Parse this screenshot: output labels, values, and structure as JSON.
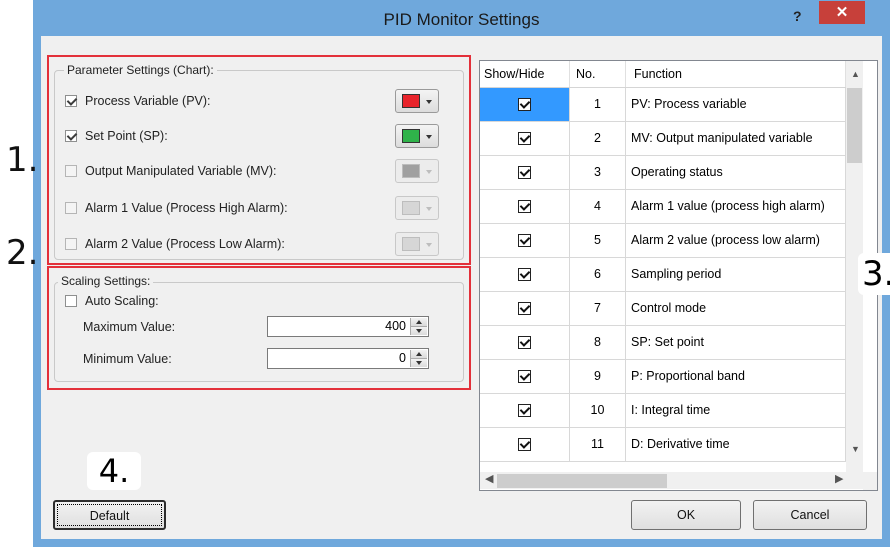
{
  "window": {
    "title": "PID Monitor Settings",
    "help": "?",
    "close": "✕"
  },
  "markers": {
    "m1": "1.",
    "m2": "2.",
    "m3": "3.",
    "m4": "4."
  },
  "params": {
    "group_label": "Parameter Settings (Chart):",
    "items": [
      {
        "label": "Process Variable (PV):",
        "checked": true,
        "enabled": true,
        "color": "#e8242b"
      },
      {
        "label": "Set Point (SP):",
        "checked": true,
        "enabled": true,
        "color": "#2fb34a"
      },
      {
        "label": "Output Manipulated Variable (MV):",
        "checked": false,
        "enabled": false,
        "color": "#a0a0a0"
      },
      {
        "label": "Alarm 1 Value (Process High Alarm):",
        "checked": false,
        "enabled": false,
        "color": "#d6d6d6"
      },
      {
        "label": "Alarm 2 Value (Process Low Alarm):",
        "checked": false,
        "enabled": false,
        "color": "#d6d6d6"
      }
    ]
  },
  "scaling": {
    "group_label": "Scaling Settings:",
    "auto_label": "Auto Scaling:",
    "max_label": "Maximum Value:",
    "max_value": "400",
    "min_label": "Minimum Value:",
    "min_value": "0"
  },
  "table": {
    "headers": [
      "Show/Hide",
      "No.",
      "Function"
    ],
    "rows": [
      {
        "no": "1",
        "func": "PV: Process variable"
      },
      {
        "no": "2",
        "func": "MV: Output manipulated variable"
      },
      {
        "no": "3",
        "func": "Operating status"
      },
      {
        "no": "4",
        "func": "Alarm 1 value (process high alarm)"
      },
      {
        "no": "5",
        "func": "Alarm 2 value (process low alarm)"
      },
      {
        "no": "6",
        "func": "Sampling period"
      },
      {
        "no": "7",
        "func": "Control mode"
      },
      {
        "no": "8",
        "func": "SP: Set point"
      },
      {
        "no": "9",
        "func": "P: Proportional band"
      },
      {
        "no": "10",
        "func": "I: Integral time"
      },
      {
        "no": "11",
        "func": "D: Derivative time"
      }
    ]
  },
  "buttons": {
    "default": "Default",
    "ok": "OK",
    "cancel": "Cancel"
  }
}
